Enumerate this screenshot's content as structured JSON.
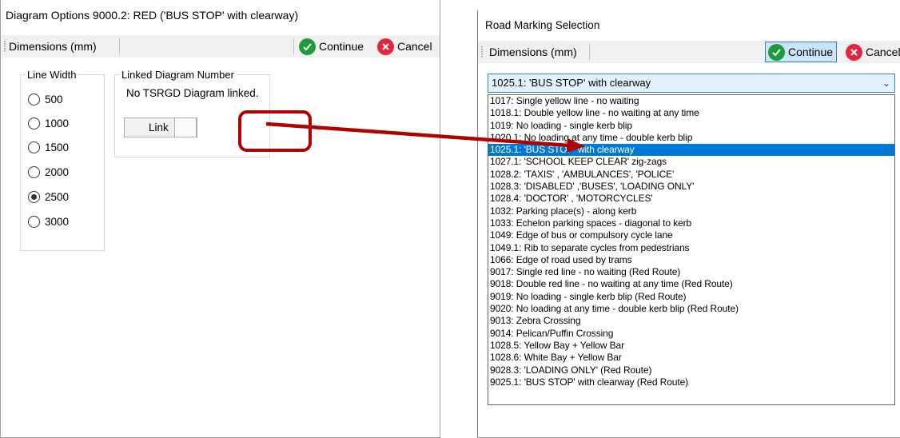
{
  "diagram_options": {
    "title": "Diagram Options 9000.2: RED ('BUS STOP' with clearway)",
    "toolbar": {
      "dimensions_label": "Dimensions (mm)",
      "continue_label": "Continue",
      "cancel_label": "Cancel"
    },
    "line_width": {
      "title": "Line Width",
      "options": [
        "500",
        "1000",
        "1500",
        "2000",
        "2500",
        "3000"
      ],
      "selected": "2500"
    },
    "linked_diagram": {
      "title": "Linked Diagram Number",
      "status": "No TSRGD Diagram linked.",
      "link_label": "Link"
    }
  },
  "road_marking": {
    "title": "Road Marking Selection",
    "toolbar": {
      "dimensions_label": "Dimensions (mm)",
      "continue_label": "Continue",
      "cancel_label": "Cancel"
    },
    "combo_value": "1025.1: 'BUS STOP' with clearway",
    "selected_index": 4,
    "items": [
      "1017: Single yellow line - no waiting",
      "1018.1: Double yellow line - no waiting at any time",
      "1019: No loading - single kerb blip",
      "1020.1: No loading at any time - double kerb blip",
      "1025.1: 'BUS STOP' with clearway",
      "1027.1: 'SCHOOL KEEP CLEAR' zig-zags",
      "1028.2: 'TAXIS' , 'AMBULANCES', 'POLICE'",
      "1028.3: 'DISABLED' ,'BUSES', 'LOADING ONLY'",
      "1028.4: 'DOCTOR' , 'MOTORCYCLES'",
      "1032: Parking place(s) - along kerb",
      "1033: Echelon parking spaces - diagonal to kerb",
      "1049: Edge of bus or compulsory cycle lane",
      "1049.1: Rib to separate cycles from pedestrians",
      "1066: Edge of road used by trams",
      "9017: Single red line - no waiting (Red Route)",
      "9018: Double red line - no waiting at any time (Red Route)",
      "9019: No loading - single kerb blip (Red Route)",
      "9020: No loading at any time - double kerb blip (Red Route)",
      "9013: Zebra Crossing",
      "9014: Pelican/Puffin Crossing",
      "1028.5: Yellow Bay + Yellow Bar",
      "1028.6: White Bay + Yellow Bar",
      "9028.3: 'LOADING ONLY' (Red Route)",
      "9025.1: 'BUS STOP' with clearway (Red Route)"
    ]
  },
  "colors": {
    "annotation": "#b00000",
    "selection": "#0078d7",
    "continue": "#1f9a3c",
    "cancel": "#e3263b"
  }
}
